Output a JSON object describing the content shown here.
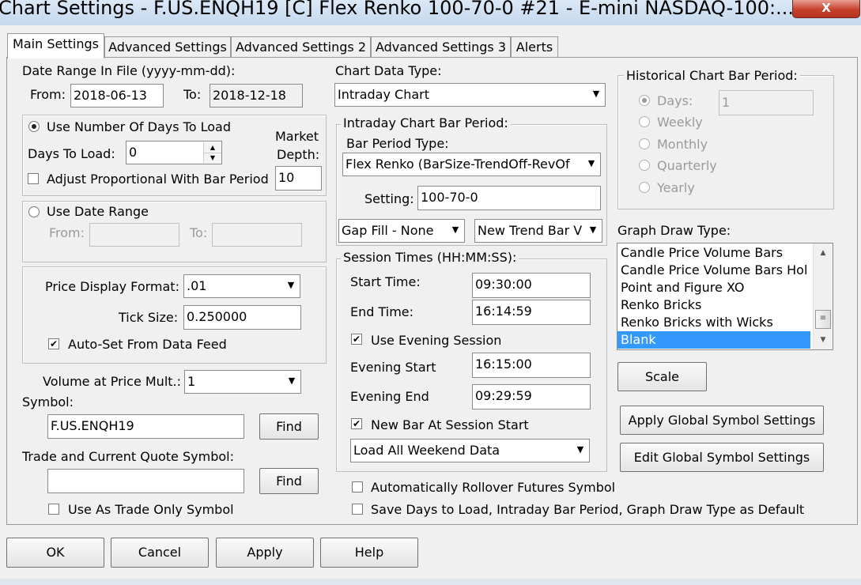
{
  "window": {
    "title": "Chart Settings - F.US.ENQH19 [C]  Flex Renko 100-70-0  #21 - E-mini NASDAQ-100:...",
    "close_label": "X"
  },
  "tabs": [
    "Main Settings",
    "Advanced Settings",
    "Advanced Settings 2",
    "Advanced Settings 3",
    "Alerts"
  ],
  "date_range": {
    "heading": "Date Range In File (yyyy-mm-dd):",
    "from_label": "From:",
    "from_value": "2018-06-13",
    "to_label": "To:",
    "to_value": "2018-12-18"
  },
  "days_group": {
    "use_days_label": "Use Number Of Days To Load",
    "days_label": "Days To Load:",
    "days_value": "0",
    "market_depth_label_1": "Market",
    "market_depth_label_2": "Depth:",
    "market_depth_value": "10",
    "adjust_label": "Adjust Proportional With Bar Period"
  },
  "date_range_group": {
    "label": "Use Date Range",
    "from_label": "From:",
    "to_label": "To:"
  },
  "price_group": {
    "format_label": "Price Display Format:",
    "format_value": ".01",
    "tick_label": "Tick Size:",
    "tick_value": "0.250000",
    "autoset_label": "Auto-Set From Data Feed"
  },
  "volume": {
    "label": "Volume at Price Mult.:",
    "value": "1"
  },
  "symbol": {
    "label": "Symbol:",
    "value": "F.US.ENQH19",
    "find_label": "Find"
  },
  "trade_symbol": {
    "label": "Trade and Current Quote Symbol:",
    "value": "",
    "find_label": "Find",
    "trade_only_label": "Use As Trade Only Symbol"
  },
  "chart_data_type": {
    "label": "Chart Data Type:",
    "value": "Intraday Chart"
  },
  "intraday_group": {
    "title": "Intraday Chart Bar Period:",
    "bar_type_label": "Bar Period Type:",
    "bar_type_value": "Flex Renko (BarSize-TrendOff-RevOf",
    "setting_label": "Setting:",
    "setting_value": "100-70-0",
    "gap_fill_value": "Gap Fill - None",
    "new_trend_value": "New Trend Bar V"
  },
  "session_group": {
    "title": "Session Times (HH:MM:SS):",
    "start_label": "Start Time:",
    "start_value": "09:30:00",
    "end_label": "End Time:",
    "end_value": "16:14:59",
    "evening_session_label": "Use Evening Session",
    "evening_start_label": "Evening Start",
    "evening_start_value": "16:15:00",
    "evening_end_label": "Evening End",
    "evening_end_value": "09:29:59",
    "new_bar_label": "New Bar At Session Start",
    "weekend_value": "Load All Weekend Data"
  },
  "rollover_label": "Automatically Rollover Futures Symbol",
  "save_default_label": "Save Days to Load, Intraday Bar Period, Graph Draw Type as Default",
  "historical_group": {
    "title": "Historical Chart Bar Period:",
    "options": [
      "Days:",
      "Weekly",
      "Monthly",
      "Quarterly",
      "Yearly"
    ],
    "days_value": "1"
  },
  "graph_draw": {
    "label": "Graph Draw Type:",
    "items": [
      "Candle Price Volume Bars",
      "Candle Price Volume Bars Hol",
      "Point and Figure XO",
      "Renko Bricks",
      "Renko Bricks with Wicks",
      "Blank"
    ],
    "selected": "Blank"
  },
  "buttons": {
    "scale": "Scale",
    "apply_global": "Apply Global Symbol Settings",
    "edit_global": "Edit Global Symbol Settings",
    "ok": "OK",
    "cancel": "Cancel",
    "apply": "Apply",
    "help": "Help"
  },
  "colors": {
    "selection": "#3399ff",
    "close_button": "#c7402b"
  }
}
